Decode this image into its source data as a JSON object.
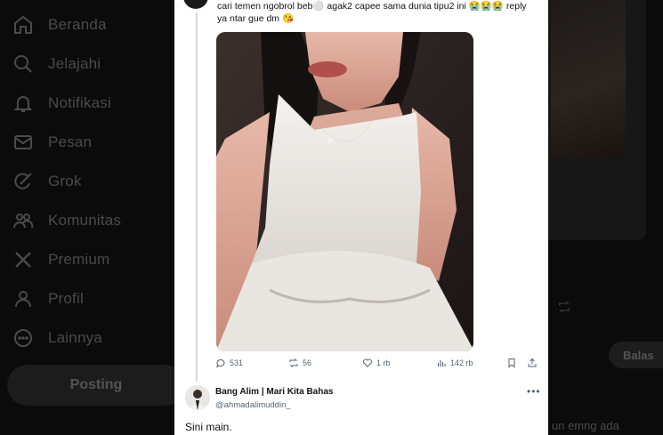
{
  "sidebar": {
    "items": [
      {
        "label": "Beranda",
        "icon": "home-icon"
      },
      {
        "label": "Jelajahi",
        "icon": "search-icon"
      },
      {
        "label": "Notifikasi",
        "icon": "bell-icon"
      },
      {
        "label": "Pesan",
        "icon": "mail-icon"
      },
      {
        "label": "Grok",
        "icon": "grok-icon"
      },
      {
        "label": "Komunitas",
        "icon": "communities-icon"
      },
      {
        "label": "Premium",
        "icon": "x-logo-icon"
      },
      {
        "label": "Profil",
        "icon": "profile-icon"
      },
      {
        "label": "Lainnya",
        "icon": "more-circle-icon"
      }
    ],
    "post_button": "Posting"
  },
  "tweet": {
    "text_line1": "cari temen ngobrol beb⚪️ agak2 capee sama dunia tipu2 ini 😭😭😭 reply",
    "text_line2": "ya ntar gue dm 😘",
    "replies": "531",
    "reposts": "56",
    "likes": "1 rb",
    "views": "142 rb"
  },
  "reply": {
    "name": "Bang Alim | Mari Kita Bahas",
    "handle": "@ahmadalimuddin_",
    "text": "Sini main."
  },
  "right_panel": {
    "balas_button": "Balas",
    "bottom_text": "un emng ada"
  },
  "colors": {
    "panel_bg": "#ffffff",
    "overlay_bg": "#000000",
    "text_primary": "#0f1419",
    "text_secondary": "#536471"
  }
}
